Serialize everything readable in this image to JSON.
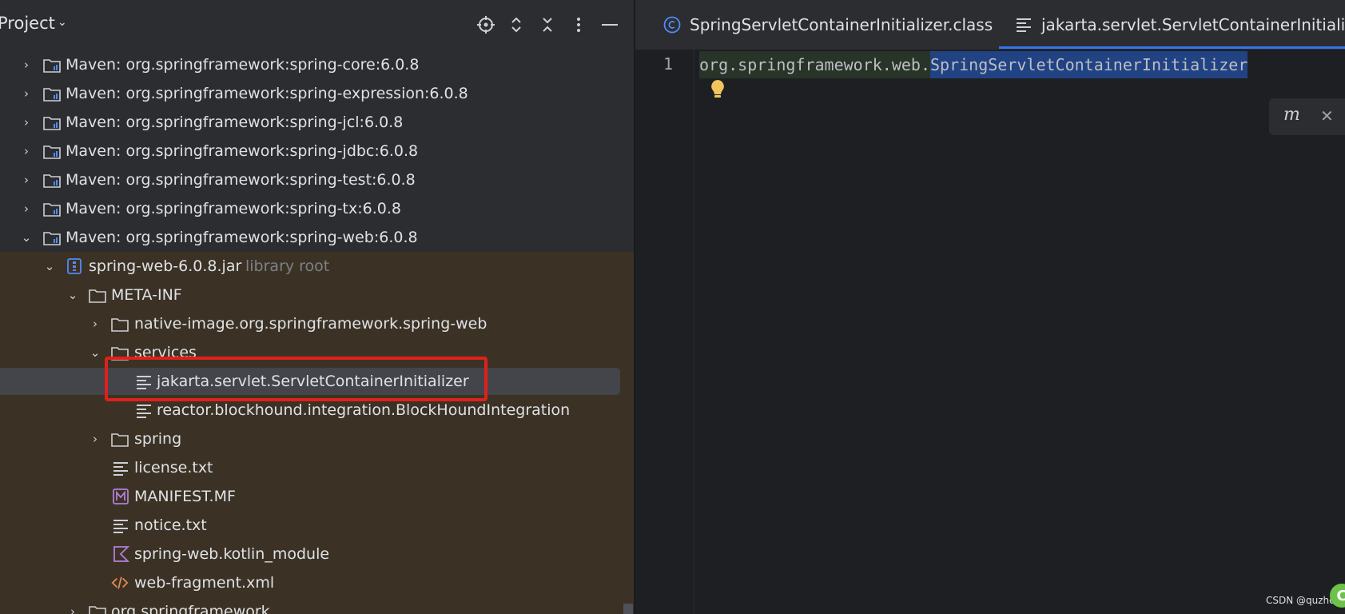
{
  "project_header": {
    "title": "Project",
    "icons": [
      "locate-icon",
      "expand-collapse-icon",
      "collapse-all-icon",
      "more-options-icon",
      "minimize-icon"
    ]
  },
  "tree": {
    "maven_libs": [
      {
        "label": "Maven: org.springframework:spring-core:6.0.8"
      },
      {
        "label": "Maven: org.springframework:spring-expression:6.0.8"
      },
      {
        "label": "Maven: org.springframework:spring-jcl:6.0.8"
      },
      {
        "label": "Maven: org.springframework:spring-jdbc:6.0.8"
      },
      {
        "label": "Maven: org.springframework:spring-test:6.0.8"
      },
      {
        "label": "Maven: org.springframework:spring-tx:6.0.8"
      },
      {
        "label": "Maven: org.springframework:spring-web:6.0.8"
      }
    ],
    "jar": {
      "label": "spring-web-6.0.8.jar",
      "hint": "library root"
    },
    "meta_inf": {
      "label": "META-INF"
    },
    "native_image": {
      "label": "native-image.org.springframework.spring-web"
    },
    "services": {
      "label": "services"
    },
    "selected_file": {
      "label": "jakarta.servlet.ServletContainerInitializer"
    },
    "blockhound_file": {
      "label": "reactor.blockhound.integration.BlockHoundIntegration"
    },
    "spring_folder": {
      "label": "spring"
    },
    "license": {
      "label": "license.txt"
    },
    "manifest": {
      "label": "MANIFEST.MF"
    },
    "notice": {
      "label": "notice.txt"
    },
    "kotlin_module": {
      "label": "spring-web.kotlin_module"
    },
    "web_fragment": {
      "label": "web-fragment.xml"
    },
    "org_springframework": {
      "label": "org.springframework"
    }
  },
  "tabs": [
    {
      "label": "SpringServletContainerInitializer.class",
      "icon": "class-icon"
    },
    {
      "label": "jakarta.servlet.ServletContainerInitializer",
      "icon": "text-file-icon",
      "active": true
    }
  ],
  "editor": {
    "line_number": "1",
    "code_prefix": "org.springframework.web.",
    "code_selected": "SpringServletContainerInitializer"
  },
  "popup": {
    "icon": "maven-reload-icon"
  },
  "watermark": "CSDN @quzhem",
  "colors": {
    "accent": "#3574f0",
    "highlight_box": "#e0201b",
    "library_bg": "#3b3225",
    "selection": "#214283"
  }
}
